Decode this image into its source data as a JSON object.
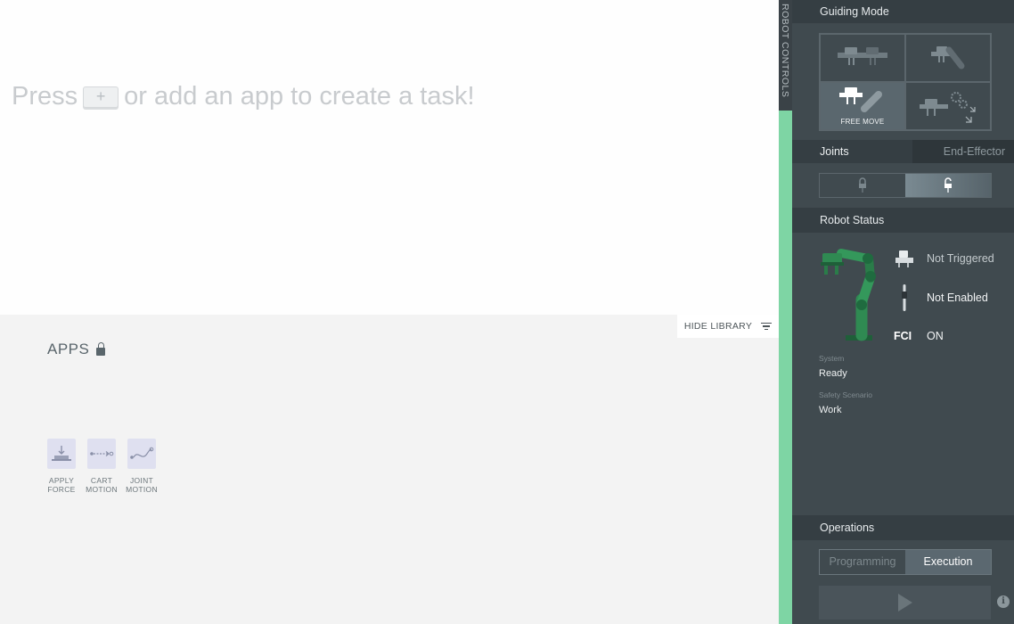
{
  "workspace": {
    "hint_before": "Press",
    "hint_key": "+",
    "hint_after": "or add an app to create a task!"
  },
  "library": {
    "hide_label": "HIDE LIBRARY",
    "apps_title": "APPS",
    "apps": [
      {
        "label": "APPLY\nFORCE",
        "icon": "apply-force-icon"
      },
      {
        "label": "CART\nMOTION",
        "icon": "cart-motion-icon"
      },
      {
        "label": "JOINT\nMOTION",
        "icon": "joint-motion-icon"
      }
    ]
  },
  "side_tab": {
    "label": "ROBOT CONTROLS"
  },
  "panel": {
    "guiding_mode": {
      "title": "Guiding Mode",
      "options": [
        {
          "icon": "translation-mode-icon",
          "label": ""
        },
        {
          "icon": "rotation-mode-icon",
          "label": ""
        },
        {
          "icon": "free-move-icon",
          "label": "FREE MOVE",
          "active": true
        },
        {
          "icon": "user-defined-mode-icon",
          "label": ""
        }
      ]
    },
    "tabs": {
      "joints": "Joints",
      "end_effector": "End-Effector",
      "active": "Joints"
    },
    "robot_status": {
      "title": "Robot Status",
      "items": [
        {
          "icon": "gripper-icon",
          "text": "Not Triggered"
        },
        {
          "icon": "enabling-device-icon",
          "text": "Not Enabled"
        },
        {
          "icon": "fci-icon",
          "label": "FCI",
          "text": "ON"
        }
      ],
      "system_label": "System",
      "system_value": "Ready",
      "safety_label": "Safety Scenario",
      "safety_value": "Work"
    },
    "operations": {
      "title": "Operations",
      "programming": "Programming",
      "execution": "Execution",
      "active": "Execution"
    }
  },
  "colors": {
    "panel_bg": "#404a4f",
    "section_header": "#353e43",
    "status_strip": "#7ed5a4",
    "robot_green": "#2f8a52"
  }
}
